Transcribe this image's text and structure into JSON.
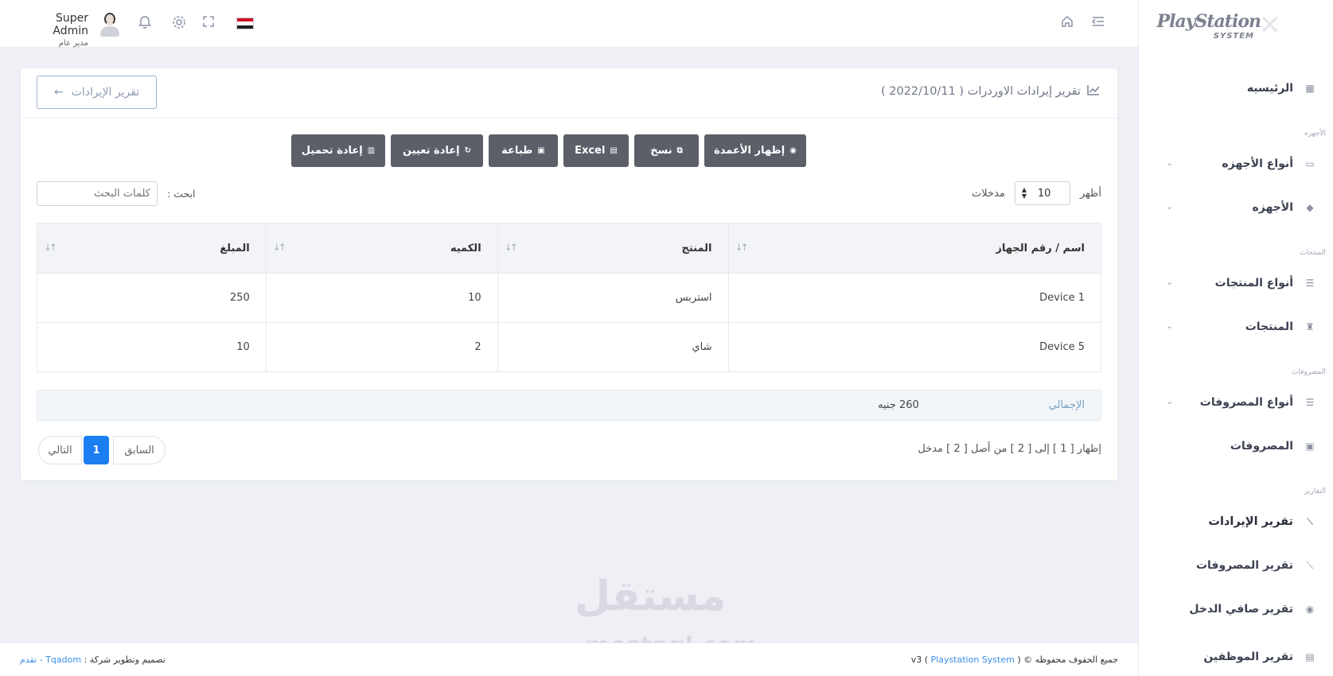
{
  "sidebar": {
    "brand_top": "PlayStation",
    "brand_bottom": "SYSTEM",
    "brand_mark": "✕",
    "items": [
      {
        "label": "الرئيسيه",
        "icon": "dashboard-icon",
        "glyph": "▦"
      },
      {
        "label": "أنواع الأجهزه",
        "icon": "monitor-icon",
        "glyph": "▭"
      },
      {
        "label": "الأجهزه",
        "icon": "gamepad-icon",
        "glyph": "◆"
      },
      {
        "label": "أنواع المنتجات",
        "icon": "list-icon",
        "glyph": "☰"
      },
      {
        "label": "المنتجات",
        "icon": "food-icon",
        "glyph": "♜"
      },
      {
        "label": "أنواع المصروفات",
        "icon": "list-icon",
        "glyph": "☰"
      },
      {
        "label": "المصروفات",
        "icon": "briefcase-icon",
        "glyph": "▣"
      },
      {
        "label": "تقرير الإيرادات",
        "icon": "chart-line-icon",
        "glyph": "⟋"
      },
      {
        "label": "تقرير المصروفات",
        "icon": "chart-line-icon",
        "glyph": "⟋"
      },
      {
        "label": "تقرير صافي الدخل",
        "icon": "coins-icon",
        "glyph": "◉"
      },
      {
        "label": "تقرير الموظفين",
        "icon": "report-icon",
        "glyph": "▤"
      }
    ],
    "sections": {
      "devices": "الأجهزه",
      "products": "المنتجات",
      "expenses": "المصروفات",
      "reports": "التقارير"
    }
  },
  "topbar": {
    "user_name": "Super Admin",
    "user_role": "مدير عام",
    "icons": [
      "bell-icon",
      "gear-icon",
      "fullscreen-icon",
      "flag-icon",
      "home-icon",
      "menu-toggle-icon"
    ]
  },
  "report": {
    "title": "تقرير إيرادات الاوردرات ( 2022/10/11 )",
    "back_label": "تقرير الإيرادات",
    "buttons": {
      "columns": "إظهار الأعمدة",
      "copy": "نسخ",
      "excel": "Excel",
      "print": "طباعة",
      "reset": "إعادة تعيين",
      "reload": "إعادة تحميل"
    },
    "length": {
      "show": "أظهر",
      "value": "10",
      "entries": "مدخلات"
    },
    "search": {
      "label": "ابحث :",
      "placeholder": "كلمات البحث"
    },
    "table": {
      "headers": [
        "اسم / رقم الجهاز",
        "المنتج",
        "الكميه",
        "المبلغ"
      ],
      "rows": [
        [
          "Device 1",
          "استربس",
          "10",
          "250"
        ],
        [
          "Device 5",
          "شاي",
          "2",
          "10"
        ]
      ]
    },
    "total": {
      "label": "الإجمالي",
      "value": "260 جنيه"
    },
    "info": "إظهار [ 1 ] إلى [ 2 ] من أصل [ 2 ] مدخل",
    "pager": {
      "prev": "السابق",
      "current": "1",
      "next": "التالي"
    }
  },
  "footer": {
    "rights": "جميع الحقوف محفوظه ©",
    "system": "Playstation System",
    "version": "v3",
    "design": "تصميم وتطوير شركة :",
    "company": "Tqadom - تقدم"
  },
  "watermark": {
    "ar": "مستقل",
    "en": "mostaql.com"
  },
  "colors": {
    "accent": "#1a7df0",
    "button": "#5c5f68",
    "link": "#3a8ee6"
  }
}
